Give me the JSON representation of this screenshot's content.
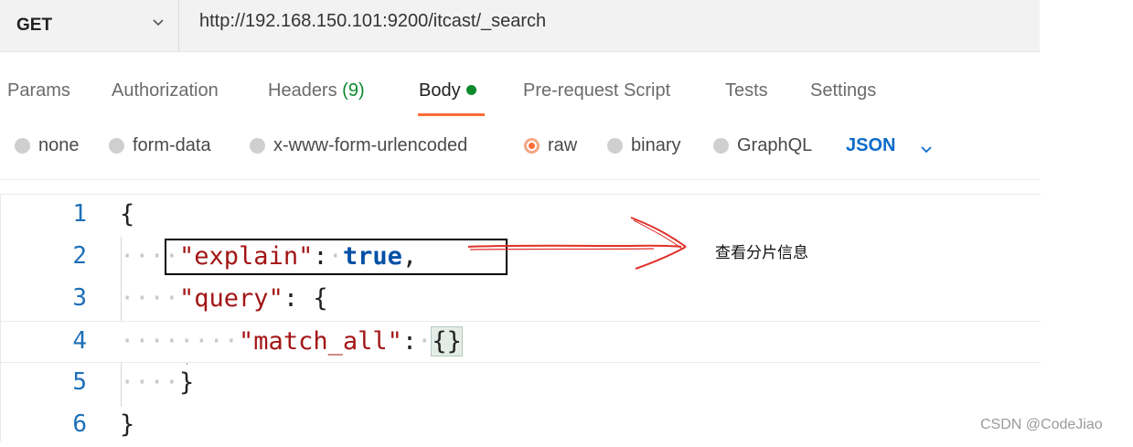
{
  "request": {
    "method": "GET",
    "url": "http://192.168.150.101:9200/itcast/_search"
  },
  "tabs": [
    {
      "label": "Params"
    },
    {
      "label": "Authorization"
    },
    {
      "label": "Headers ",
      "count": "(9)"
    },
    {
      "label": "Body",
      "active": true
    },
    {
      "label": "Pre-request Script"
    },
    {
      "label": "Tests"
    },
    {
      "label": "Settings"
    }
  ],
  "body_types": [
    {
      "label": "none"
    },
    {
      "label": "form-data"
    },
    {
      "label": "x-www-form-urlencoded"
    },
    {
      "label": "raw",
      "selected": true
    },
    {
      "label": "binary"
    },
    {
      "label": "GraphQL"
    }
  ],
  "format": "JSON",
  "editor": {
    "line_numbers": [
      "1",
      "2",
      "3",
      "4",
      "5",
      "6"
    ],
    "lines": {
      "l1": "{",
      "l2_key": "\"explain\"",
      "l2_colon": ":",
      "l2_value": "true",
      "l2_comma": ",",
      "l3_key": "\"query\"",
      "l3_rest": ": {",
      "l4_key": "\"match_all\"",
      "l4_colon": ":",
      "l4_value": "{}",
      "l5": "}",
      "l6": "}"
    }
  },
  "annotation": {
    "text": "查看分片信息",
    "color": "#e0302a"
  },
  "watermark": "CSDN @CodeJiao",
  "colors": {
    "accent": "#ff6c37",
    "success": "#0c8a2c",
    "link": "#0b6bcb"
  },
  "icons": {
    "method_caret": "chevron-down-icon",
    "format_caret": "chevron-down-icon"
  }
}
